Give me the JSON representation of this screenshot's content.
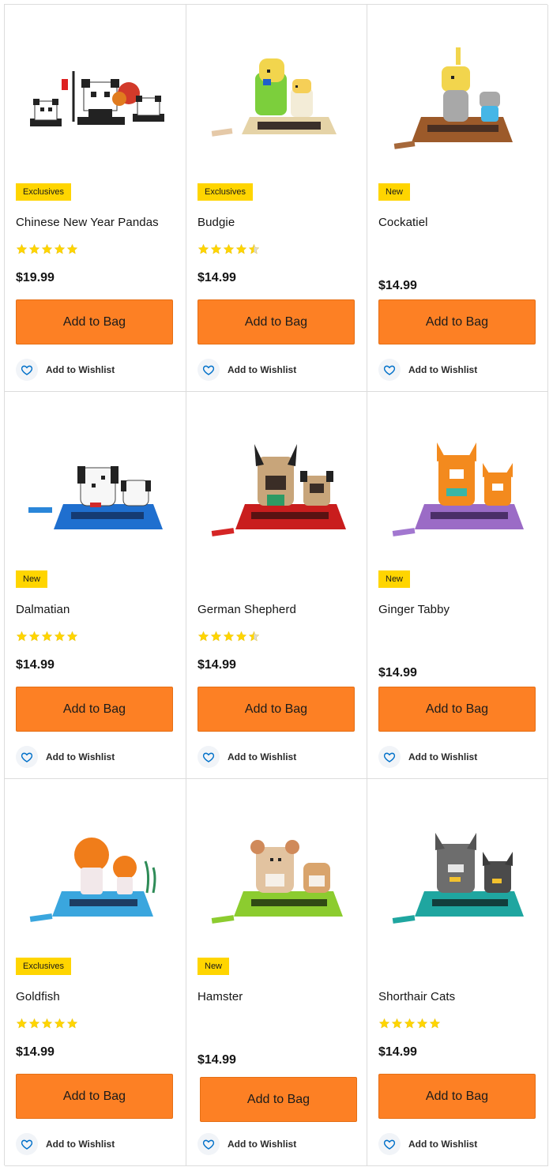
{
  "actions": {
    "add_to_bag": "Add to Bag",
    "add_to_wishlist": "Add to Wishlist"
  },
  "colors": {
    "badge": "#ffd500",
    "button": "#fd8024",
    "star": "#ffd500",
    "heart": "#0070c9"
  },
  "products": [
    {
      "badge": "Exclusives",
      "title": "Chinese New Year Pandas",
      "rating": 5,
      "price": "$19.99",
      "image": "pandas-set"
    },
    {
      "badge": "Exclusives",
      "title": "Budgie",
      "rating": 4.5,
      "price": "$14.99",
      "image": "budgie-set"
    },
    {
      "badge": "New",
      "title": "Cockatiel",
      "rating": 0,
      "price": "$14.99",
      "image": "cockatiel-set"
    },
    {
      "badge": "New",
      "title": "Dalmatian",
      "rating": 5,
      "price": "$14.99",
      "image": "dalmatian-set"
    },
    {
      "badge": "",
      "title": "German Shepherd",
      "rating": 4.5,
      "price": "$14.99",
      "image": "german-shepherd-set"
    },
    {
      "badge": "New",
      "title": "Ginger Tabby",
      "rating": 0,
      "price": "$14.99",
      "image": "ginger-tabby-set"
    },
    {
      "badge": "Exclusives",
      "title": "Goldfish",
      "rating": 5,
      "price": "$14.99",
      "image": "goldfish-set"
    },
    {
      "badge": "New",
      "title": "Hamster",
      "rating": 0,
      "price": "$14.99",
      "image": "hamster-set"
    },
    {
      "badge": "",
      "title": "Shorthair Cats",
      "rating": 5,
      "price": "$14.99",
      "image": "shorthair-cats-set"
    }
  ]
}
